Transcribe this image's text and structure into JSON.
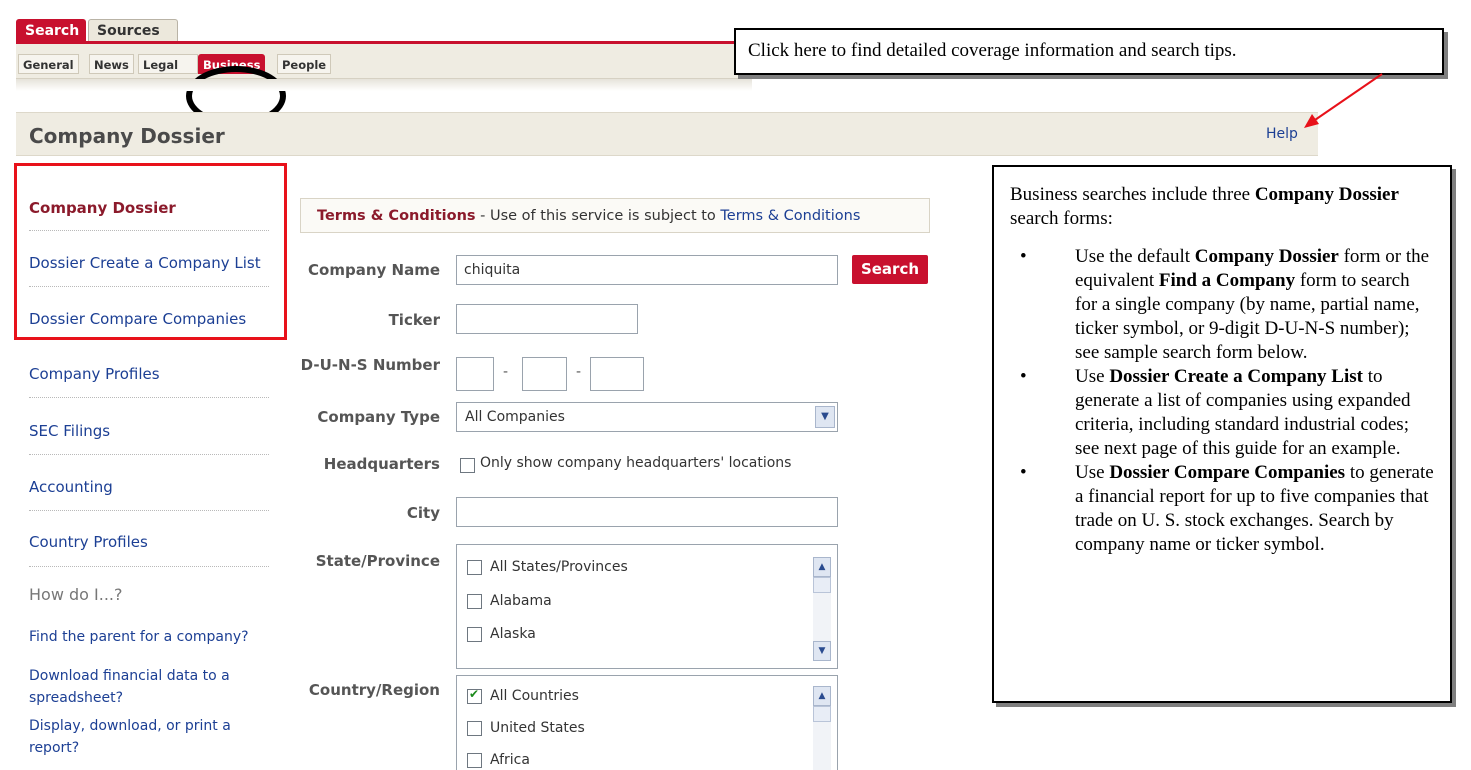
{
  "tabs": {
    "primary": [
      "Search",
      "Sources"
    ],
    "secondary": [
      "General",
      "News",
      "Legal",
      "Business",
      "People"
    ]
  },
  "callouts": {
    "top": "Click here to find detailed coverage information and search tips.",
    "right": {
      "intro_a": "Business searches include three ",
      "intro_bold": "Company Dossier",
      "intro_b": " search forms:",
      "bullet1": [
        "Use the default ",
        "Company Dossier",
        " form or the equivalent ",
        "Find a Company",
        " form to search for a single company (by name, partial name, ticker symbol, or 9-digit D-U-N-S number); see sample search form below."
      ],
      "bullet2": [
        "Use ",
        "Dossier Create a Company List",
        " to generate a list of companies using expanded criteria, including standard industrial codes; see next page of this guide for an example."
      ],
      "bullet3": [
        "Use ",
        "Dossier Compare Companies",
        " to generate a financial report for up to five companies that trade on U. S. stock exchanges. Search by company name or ticker symbol."
      ]
    }
  },
  "header": {
    "title": "Company Dossier",
    "help": "Help"
  },
  "sidebar": {
    "items": [
      "Company Dossier",
      "Dossier Create a Company List",
      "Dossier Compare Companies",
      "Company Profiles",
      "SEC Filings",
      "Accounting",
      "Country Profiles"
    ],
    "howdo": "How do I...?",
    "help_links": [
      "Find the parent for a company?",
      "Download financial data to a spreadsheet?",
      "Display, download, or print a report?"
    ]
  },
  "form": {
    "terms_label": "Terms & Conditions",
    "terms_text": " - Use of this service is subject to ",
    "terms_link": "Terms & Conditions",
    "company_name_label": "Company Name",
    "company_name_value": "chiquita",
    "search_button": "Search",
    "ticker_label": "Ticker",
    "duns_label": "D-U-N-S Number",
    "company_type_label": "Company Type",
    "company_type_value": "All Companies",
    "hq_label": "Headquarters",
    "hq_checkbox": "Only show company headquarters' locations",
    "city_label": "City",
    "state_label": "State/Province",
    "states": [
      "All States/Provinces",
      "Alabama",
      "Alaska"
    ],
    "country_label": "Country/Region",
    "countries": [
      "All Countries",
      "United States",
      "Africa"
    ]
  }
}
